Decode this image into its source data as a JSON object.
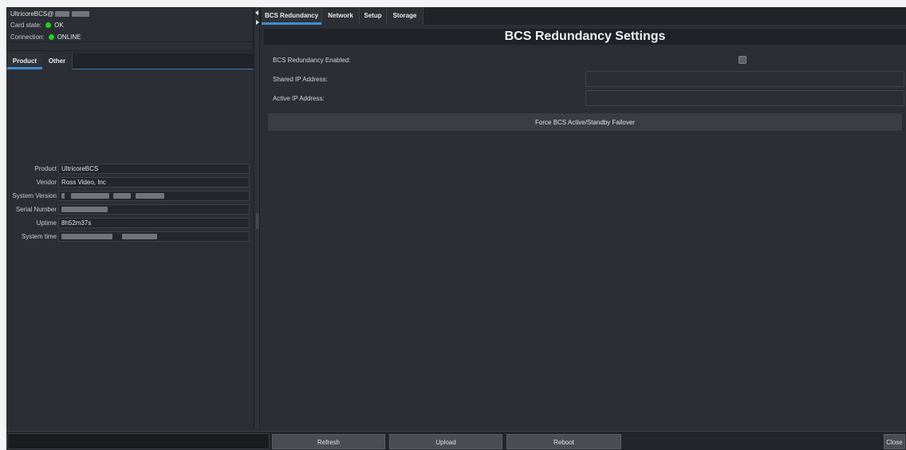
{
  "info": {
    "host_prefix": "UltricoreBCS@",
    "card_state_label": "Card state:",
    "card_state_value": "OK",
    "connection_label": "Connection:",
    "connection_value": "ONLINE"
  },
  "left_tabs": [
    {
      "label": "Product",
      "active": true
    },
    {
      "label": "Other",
      "active": false
    }
  ],
  "product": {
    "rows": [
      {
        "label": "Product",
        "value": "UltricoreBCS"
      },
      {
        "label": "Vendor",
        "value": "Ross Video, Inc"
      },
      {
        "label": "System Version",
        "value": ""
      },
      {
        "label": "Serial Number",
        "value": ""
      },
      {
        "label": "Uptime",
        "value": "8h52m37s"
      },
      {
        "label": "System time",
        "value": ""
      }
    ]
  },
  "right_tabs": [
    {
      "label": "BCS Redundancy",
      "active": true
    },
    {
      "label": "Network",
      "active": false
    },
    {
      "label": "Setup",
      "active": false
    },
    {
      "label": "Storage",
      "active": false
    }
  ],
  "settings": {
    "title": "BCS Redundancy Settings",
    "enabled_label": "BCS Redundancy Enabled:",
    "enabled_checked": false,
    "shared_ip_label": "Shared IP Address:",
    "shared_ip_value": "",
    "active_ip_label": "Active IP Address:",
    "active_ip_value": "",
    "failover_label": "Force BCS Active/Standby Failover"
  },
  "bottom": {
    "refresh_label": "Refresh",
    "upload_label": "Upload",
    "reboot_label": "Reboot",
    "close_label": "Close"
  },
  "colors": {
    "status_ok": "#1fd51f",
    "accent": "#3f8dd0",
    "panel_bg": "#2b2e34"
  },
  "icons": {
    "collapse": "arrow-left-icon",
    "expand": "arrow-right-icon",
    "splitter_grip": "grip-icon"
  }
}
